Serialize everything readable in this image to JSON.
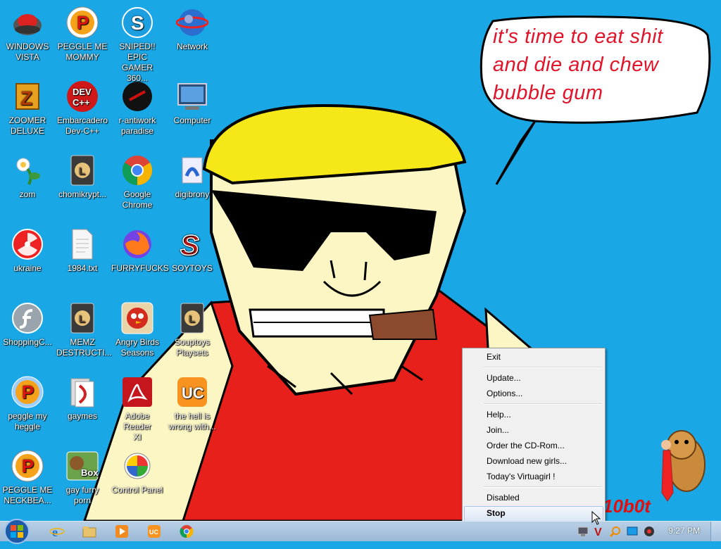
{
  "desktop_icons": [
    {
      "label": "WINDOWS\nVISTA",
      "icon": "vista-ball-icon"
    },
    {
      "label": "PEGGLE ME\nMOMMY",
      "icon": "peggle-icon"
    },
    {
      "label": "SNIPED!! EPIC\nGAMER 360...",
      "icon": "skype-icon"
    },
    {
      "label": "Network",
      "icon": "network-icon"
    },
    {
      "label": "ZOOMER\nDELUXE",
      "icon": "zuma-icon"
    },
    {
      "label": "Embarcadero\nDev-C++",
      "icon": "devcpp-icon"
    },
    {
      "label": "r-antiwork\nparadise",
      "icon": "antiwork-icon"
    },
    {
      "label": "Computer",
      "icon": "computer-icon"
    },
    {
      "label": "zom",
      "icon": "plant-icon"
    },
    {
      "label": "chomikrypt...",
      "icon": "shortcut-l-icon"
    },
    {
      "label": "Google\nChrome",
      "icon": "chrome-icon"
    },
    {
      "label": "digibrony",
      "icon": "digibrony-icon"
    },
    {
      "label": "ukraine",
      "icon": "radiation-icon"
    },
    {
      "label": "1984.txt",
      "icon": "text-file-icon"
    },
    {
      "label": "FURRYFUCKS",
      "icon": "firefox-icon"
    },
    {
      "label": "SOYTOYS",
      "icon": "soytoys-icon"
    },
    {
      "label": "ShoppingC...",
      "icon": "flash-icon"
    },
    {
      "label": "MEMZ\nDESTRUCTI...",
      "icon": "shortcut-l-icon"
    },
    {
      "label": "Angry Birds\nSeasons",
      "icon": "angry-birds-icon"
    },
    {
      "label": "Souptoys\nPlaysets",
      "icon": "shortcut-l-icon"
    },
    {
      "label": "peggle my\nheggle",
      "icon": "peggle-icon"
    },
    {
      "label": "gaymes",
      "icon": "games-folder-icon"
    },
    {
      "label": "Adobe Reader\nXI",
      "icon": "adobe-reader-icon"
    },
    {
      "label": "the hell is\nwrong with...",
      "icon": "uc-browser-icon"
    },
    {
      "label": "PEGGLE ME\nNECKBEA...",
      "icon": "peggle-icon"
    },
    {
      "label": "gay furry\nporn",
      "icon": "box-beaver-icon"
    },
    {
      "label": "Control Panel",
      "icon": "control-panel-icon"
    }
  ],
  "speech_bubble": [
    "it's time to eat shit",
    "and die and chew",
    "bubble gum"
  ],
  "wallpaper_tag": "10b0t",
  "context_menu": {
    "items": [
      "Exit",
      "Update...",
      "Options...",
      "Help...",
      "Join...",
      "Order the CD-Rom...",
      "Download new girls...",
      "Today's Virtuagirl !",
      "Disabled",
      "Stop"
    ],
    "highlighted": "Stop"
  },
  "taskbar": {
    "pinned": [
      "internet-explorer-icon",
      "explorer-folder-icon",
      "media-player-icon",
      "uc-browser-icon",
      "chrome-icon"
    ],
    "tray_icons": [
      "network-tray-icon",
      "virtuagirl-tray-icon",
      "search-tray-icon",
      "monitor-tray-icon",
      "webcam-tray-icon"
    ],
    "clock": "9:27 PM"
  },
  "colors": {
    "desktop_bg": "#1aa7e6",
    "speech_text": "#e0142a",
    "menu_bg": "#f0f0f0"
  }
}
